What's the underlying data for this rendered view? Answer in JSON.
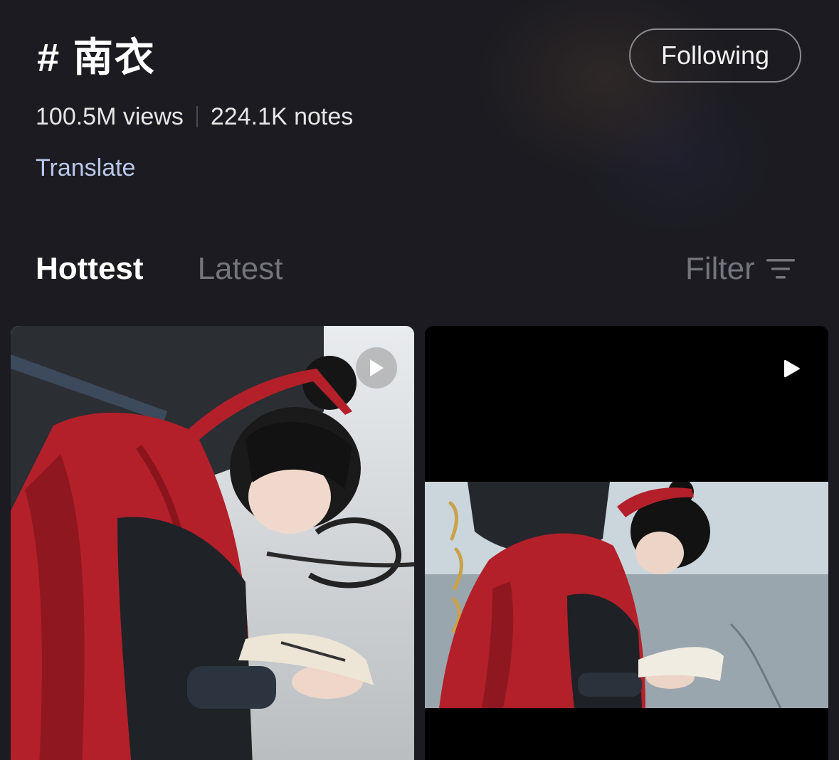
{
  "header": {
    "title": "# 南衣",
    "follow_label": "Following",
    "views": "100.5M views",
    "notes": "224.1K notes",
    "translate_label": "Translate"
  },
  "tabs": [
    {
      "label": "Hottest",
      "active": true
    },
    {
      "label": "Latest",
      "active": false
    }
  ],
  "filter": {
    "label": "Filter",
    "icon": "filter-lines-icon"
  },
  "posts": [
    {
      "type": "video",
      "icon": "play-circle-icon"
    },
    {
      "type": "video",
      "icon": "play-icon"
    }
  ],
  "colors": {
    "background": "#1b1b21",
    "accent_link": "#b9c8ea",
    "inactive_tab": "#74747c",
    "red_cloak": "#b3202a"
  }
}
